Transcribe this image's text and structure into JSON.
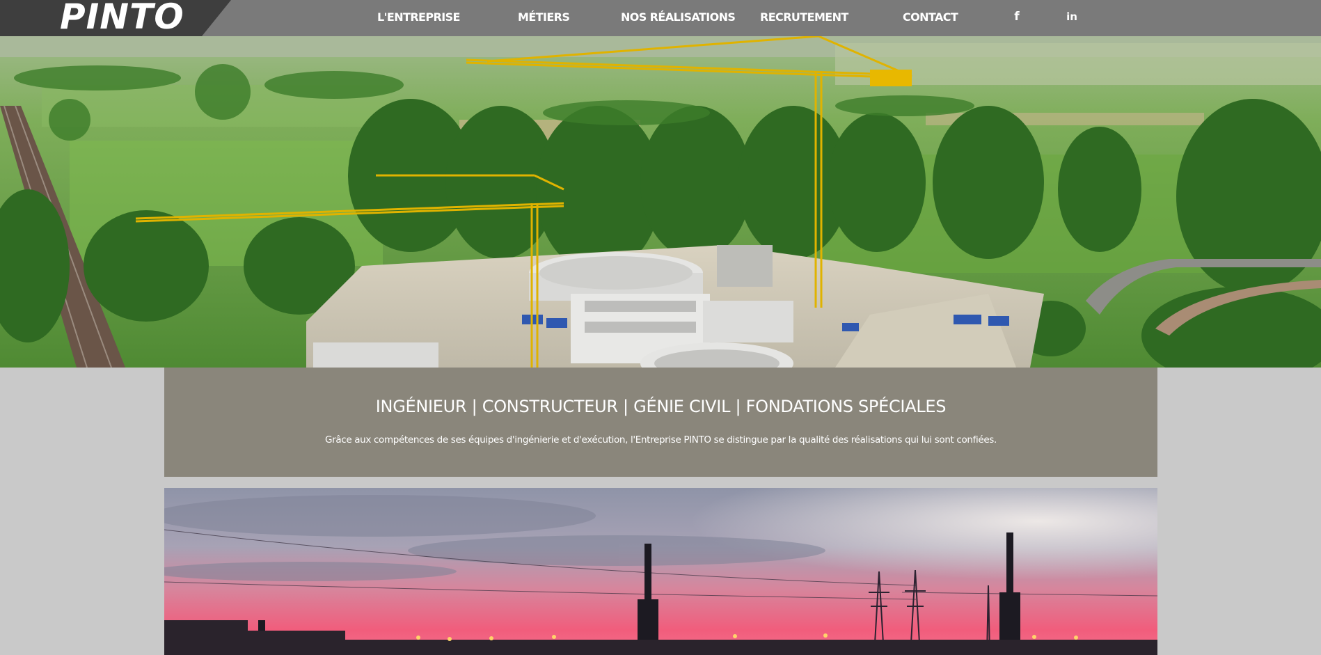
{
  "brand": {
    "logo_text": "PINTO"
  },
  "nav": {
    "items": [
      {
        "label": "L'ENTREPRISE"
      },
      {
        "label": "MÉTIERS"
      },
      {
        "label": "NOS RÉALISATIONS"
      },
      {
        "label": "RECRUTEMENT"
      },
      {
        "label": "CONTACT"
      }
    ],
    "social": [
      {
        "icon": "facebook-icon",
        "glyph": "f"
      },
      {
        "icon": "linkedin-icon",
        "glyph": "in"
      }
    ]
  },
  "intro": {
    "title": "INGÉNIEUR | CONSTRUCTEUR | GÉNIE CIVIL | FONDATIONS SPÉCIALES",
    "text": "Grâce aux compétences de ses équipes d'ingénierie et d'exécution, l'Entreprise PINTO se distingue par la qualité des réalisations qui lui sont confiées."
  },
  "colors": {
    "topbar": "#7a7a7a",
    "intro_band": "#8a867b",
    "page_background": "#c9c9c9"
  }
}
